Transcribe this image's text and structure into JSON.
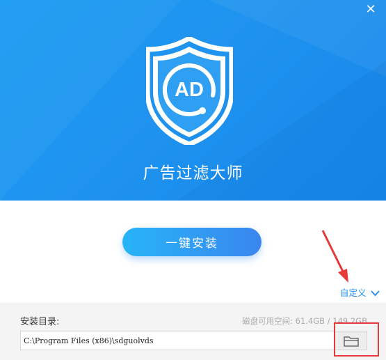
{
  "window": {
    "close_icon": "close-icon",
    "accent_color": "#1f93ef"
  },
  "hero": {
    "logo_text": "AD",
    "app_title": "广告过滤大师"
  },
  "install": {
    "button_label": "一键安装"
  },
  "custom": {
    "label": "自定义",
    "icon": "chevron-down-icon"
  },
  "install_dir": {
    "label": "安装目录:",
    "disk_space": "磁盘可用空间: 61.4GB / 149.2GB",
    "path_value": "C:\\Program Files (x86)\\sdguolvds",
    "browse_icon": "folder-icon"
  },
  "annotation": {
    "color": "#e43a3a"
  }
}
